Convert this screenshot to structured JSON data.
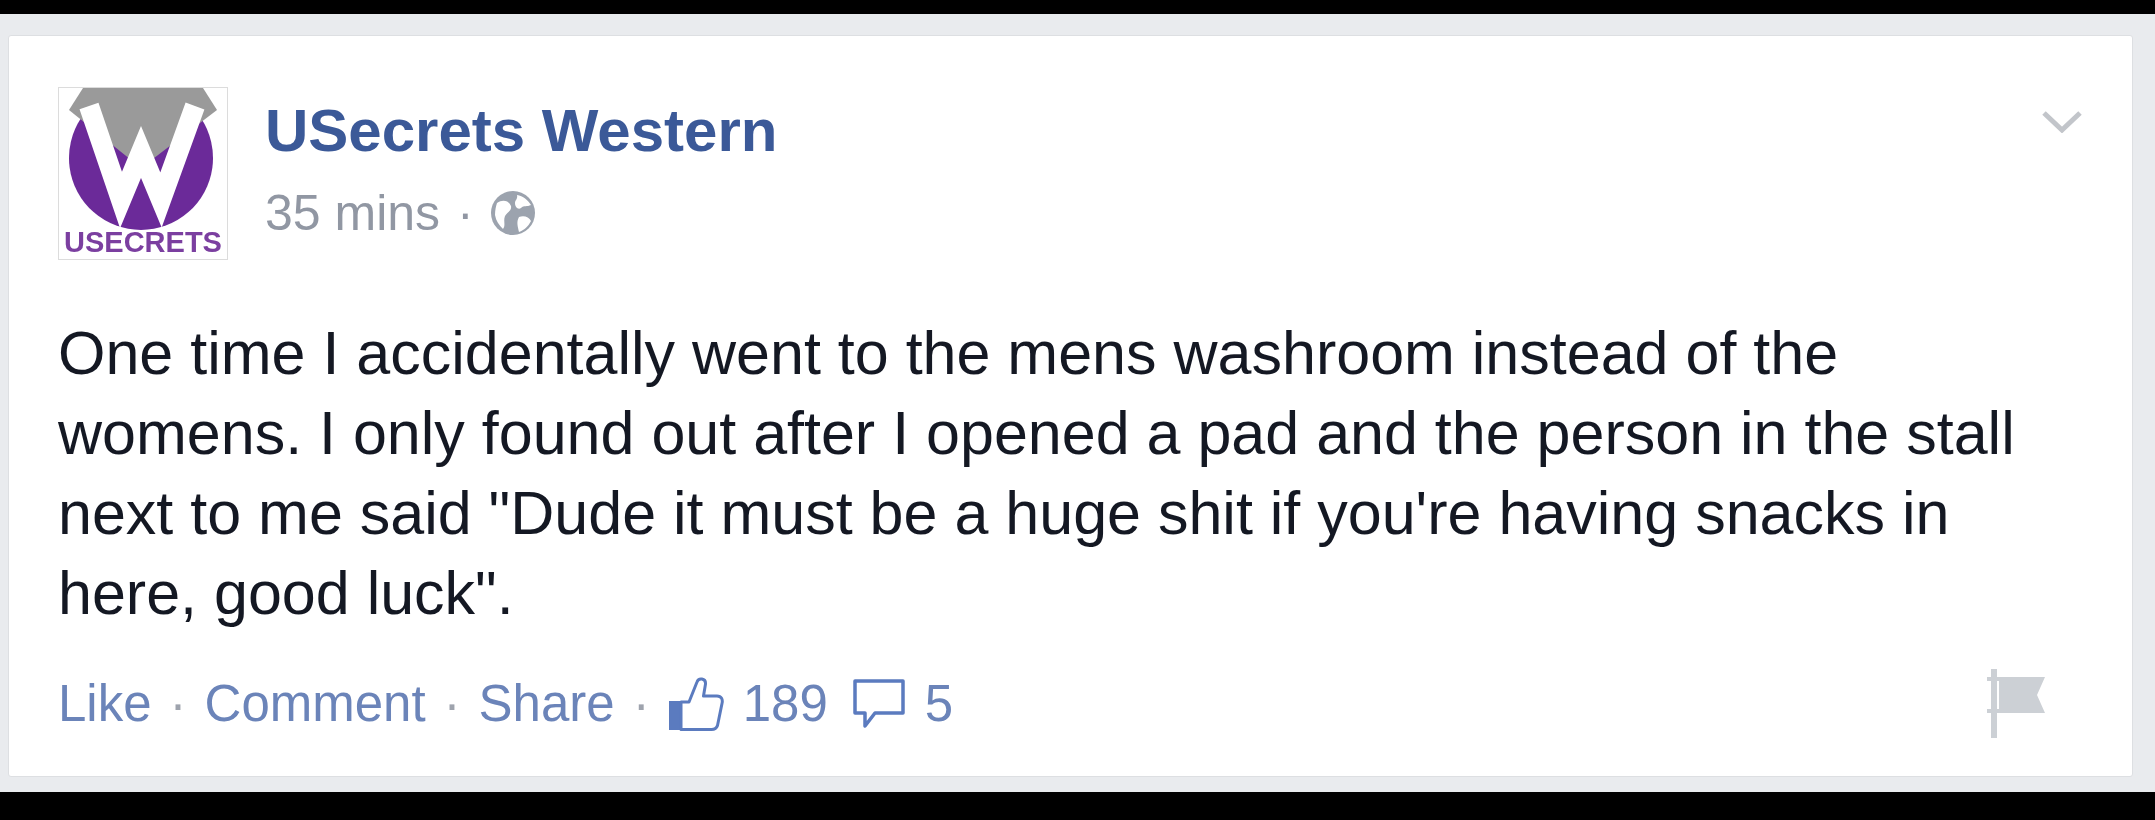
{
  "post": {
    "avatar": {
      "caption": "USECRETS"
    },
    "author": "USecrets Western",
    "meta": {
      "time": "35 mins",
      "separator": "·"
    },
    "text": "One time I accidentally went to the mens washroom instead of the womens. I only found out after I opened a pad and the person in the stall next to me said \"Dude it must be a huge shit if you're having snacks in here, good luck\".",
    "actions": [
      {
        "label": "Like",
        "separator": "·"
      },
      {
        "label": "Comment",
        "separator": "·"
      },
      {
        "label": "Share",
        "separator": "·"
      }
    ],
    "reactions": {
      "likes": "189",
      "comments": "5"
    }
  }
}
